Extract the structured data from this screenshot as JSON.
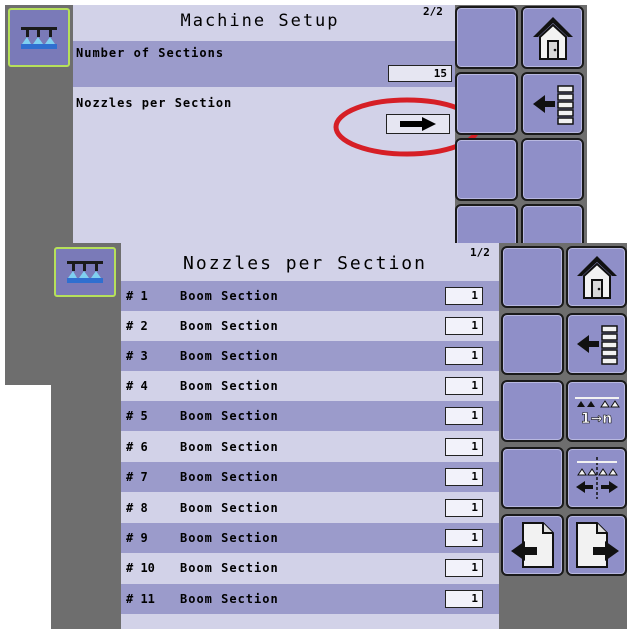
{
  "back_screen": {
    "title": "Machine Setup",
    "page": "2/2",
    "number_of_sections_label": "Number of Sections",
    "number_of_sections_value": "15",
    "nozzles_label": "Nozzles per Section"
  },
  "front_screen": {
    "title": "Nozzles per Section",
    "page": "1/2",
    "rows": [
      {
        "num": "# 1",
        "name": "Boom Section",
        "value": "1"
      },
      {
        "num": "# 2",
        "name": "Boom Section",
        "value": "1"
      },
      {
        "num": "# 3",
        "name": "Boom Section",
        "value": "1"
      },
      {
        "num": "# 4",
        "name": "Boom Section",
        "value": "1"
      },
      {
        "num": "# 5",
        "name": "Boom Section",
        "value": "1"
      },
      {
        "num": "# 6",
        "name": "Boom Section",
        "value": "1"
      },
      {
        "num": "# 7",
        "name": "Boom Section",
        "value": "1"
      },
      {
        "num": "# 8",
        "name": "Boom Section",
        "value": "1"
      },
      {
        "num": "# 9",
        "name": "Boom Section",
        "value": "1"
      },
      {
        "num": "# 10",
        "name": "Boom Section",
        "value": "1"
      },
      {
        "num": "# 11",
        "name": "Boom Section",
        "value": "1"
      }
    ],
    "apply_all_label": "1→n"
  },
  "icons": {
    "header": "boom-sprayer-icon",
    "home": "home-icon",
    "back": "back-list-icon",
    "apply_all": "apply-to-all-icon",
    "split": "boom-split-icon",
    "prev_page": "previous-page-icon",
    "next_page": "next-page-icon",
    "select_arrow": "right-arrow-icon"
  },
  "colors": {
    "panel": "#d2d2e8",
    "band": "#9b9bcb",
    "button": "#8f8fc8",
    "frame": "#6e6e6e",
    "highlight_ring": "#d61f26",
    "header_icon_border": "#b6e05a"
  }
}
